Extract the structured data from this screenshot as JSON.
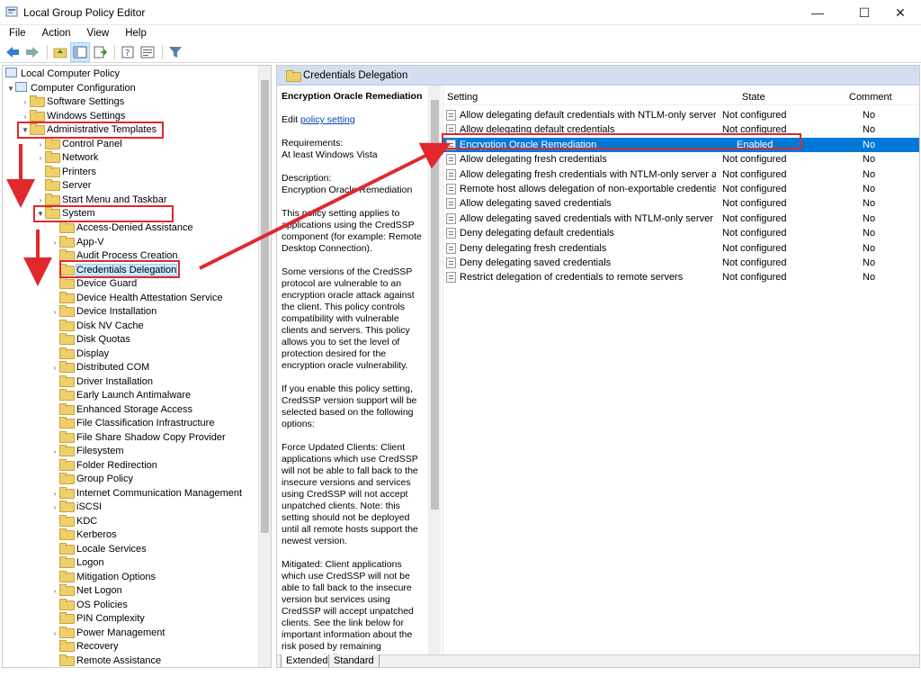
{
  "window": {
    "title": "Local Group Policy Editor",
    "minimize": "—",
    "maximize": "☐",
    "close": "✕"
  },
  "menu": [
    "File",
    "Action",
    "View",
    "Help"
  ],
  "toolbar": [
    "back-icon",
    "forward-icon",
    "up-folder-icon",
    "show-hide-tree-icon",
    "export-list-icon",
    "help-icon",
    "properties-icon",
    "filter-icon"
  ],
  "tree": {
    "root": "Local Computer Policy",
    "computer_configuration": "Computer Configuration",
    "software_settings": "Software Settings",
    "windows_settings": "Windows Settings",
    "administrative_templates": "Administrative Templates",
    "control_panel": "Control Panel",
    "network": "Network",
    "printers": "Printers",
    "server": "Server",
    "start_menu": "Start Menu and Taskbar",
    "system": "System",
    "system_children": [
      "Access-Denied Assistance",
      "App-V",
      "Audit Process Creation",
      "Credentials Delegation",
      "Device Guard",
      "Device Health Attestation Service",
      "Device Installation",
      "Disk NV Cache",
      "Disk Quotas",
      "Display",
      "Distributed COM",
      "Driver Installation",
      "Early Launch Antimalware",
      "Enhanced Storage Access",
      "File Classification Infrastructure",
      "File Share Shadow Copy Provider",
      "Filesystem",
      "Folder Redirection",
      "Group Policy",
      "Internet Communication Management",
      "iSCSI",
      "KDC",
      "Kerberos",
      "Locale Services",
      "Logon",
      "Mitigation Options",
      "Net Logon",
      "OS Policies",
      "PIN Complexity",
      "Power Management",
      "Recovery",
      "Remote Assistance"
    ]
  },
  "right_header": "Credentials Delegation",
  "description": {
    "title": "Encryption Oracle Remediation",
    "edit_prefix": "Edit",
    "edit_link": "policy setting",
    "requirements_label": "Requirements:",
    "requirements": "At least Windows Vista",
    "description_label": "Description:",
    "description": "Encryption Oracle Remediation",
    "p1": "This policy setting applies to applications using the CredSSP component (for example: Remote Desktop Connection).",
    "p2": "Some versions of the CredSSP protocol are vulnerable to an encryption oracle attack against the client.  This policy controls compatibility with vulnerable clients and servers.  This policy allows you to set the level of protection desired for the encryption oracle vulnerability.",
    "p3": "If you enable this policy setting, CredSSP version support will be selected based on the following options:",
    "p4": "Force Updated Clients: Client applications which use CredSSP will not be able to fall back to the insecure versions and services using CredSSP will not accept unpatched clients. Note: this setting should not be deployed until all remote hosts support the newest version.",
    "p5": "Mitigated: Client applications which use CredSSP will not be able to fall back to the insecure version but services using CredSSP will accept unpatched clients. See the link below for important information about the risk posed by remaining unpatched clients."
  },
  "list": {
    "headers": {
      "setting": "Setting",
      "state": "State",
      "comment": "Comment"
    },
    "rows": [
      {
        "setting": "Allow delegating default credentials with NTLM-only server a...",
        "state": "Not configured",
        "comment": "No"
      },
      {
        "setting": "Allow delegating default credentials",
        "state": "Not configured",
        "comment": "No"
      },
      {
        "setting": "Encryption Oracle Remediation",
        "state": "Enabled",
        "comment": "No"
      },
      {
        "setting": "Allow delegating fresh credentials",
        "state": "Not configured",
        "comment": "No"
      },
      {
        "setting": "Allow delegating fresh credentials with NTLM-only server aut...",
        "state": "Not configured",
        "comment": "No"
      },
      {
        "setting": "Remote host allows delegation of non-exportable credentials",
        "state": "Not configured",
        "comment": "No"
      },
      {
        "setting": "Allow delegating saved credentials",
        "state": "Not configured",
        "comment": "No"
      },
      {
        "setting": "Allow delegating saved credentials with NTLM-only server au...",
        "state": "Not configured",
        "comment": "No"
      },
      {
        "setting": "Deny delegating default credentials",
        "state": "Not configured",
        "comment": "No"
      },
      {
        "setting": "Deny delegating fresh credentials",
        "state": "Not configured",
        "comment": "No"
      },
      {
        "setting": "Deny delegating saved credentials",
        "state": "Not configured",
        "comment": "No"
      },
      {
        "setting": "Restrict delegation of credentials to remote servers",
        "state": "Not configured",
        "comment": "No"
      }
    ]
  },
  "tabs": {
    "extended": "Extended",
    "standard": "Standard"
  },
  "colors": {
    "annotation": "#e0282e",
    "selection": "#0078d7",
    "header": "#d3dfef"
  }
}
